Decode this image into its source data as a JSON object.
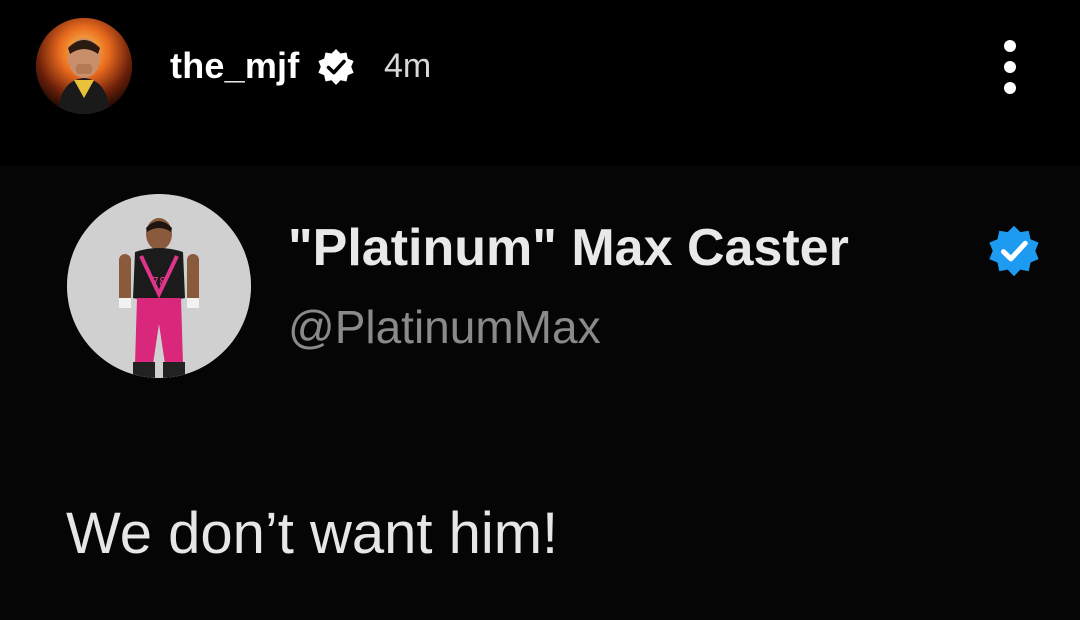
{
  "story": {
    "username": "the_mjf",
    "time": "4m",
    "avatar_icon": "avatar-image",
    "verified_icon": "verified-badge-icon",
    "more_icon": "more-options-icon"
  },
  "tweet": {
    "display_name": "\"Platinum\" Max Caster",
    "handle": "@PlatinumMax",
    "text": "We don’t want him!",
    "verified_color": "#1d9bf0",
    "avatar_icon": "avatar-image"
  },
  "colors": {
    "background": "#000000",
    "primary_text": "#ffffff",
    "secondary_text": "#8a8a8a"
  }
}
